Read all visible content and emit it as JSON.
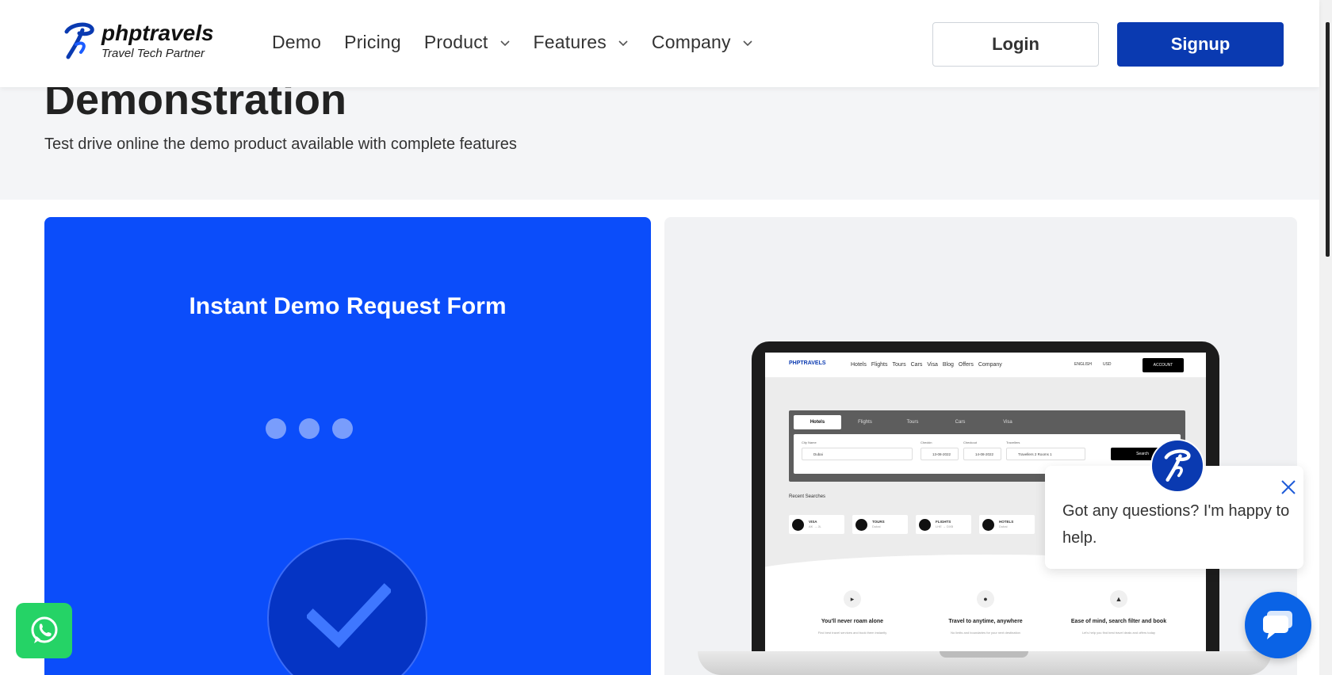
{
  "header": {
    "logo": {
      "name": "phptravels",
      "tagline": "Travel Tech Partner"
    },
    "nav": [
      {
        "label": "Demo",
        "has_dropdown": false
      },
      {
        "label": "Pricing",
        "has_dropdown": false
      },
      {
        "label": "Product",
        "has_dropdown": true
      },
      {
        "label": "Features",
        "has_dropdown": true
      },
      {
        "label": "Company",
        "has_dropdown": true
      }
    ],
    "login_label": "Login",
    "signup_label": "Signup"
  },
  "hero": {
    "title": "Demonstration",
    "subtitle": "Test drive online the demo product available with complete features"
  },
  "form_panel": {
    "title": "Instant Demo Request Form",
    "loading_dots": 3
  },
  "preview": {
    "nav_logo": "PHPTRAVELS",
    "nav_links": [
      "Hotels",
      "Flights",
      "Tours",
      "Cars",
      "Visa",
      "Blog",
      "Offers",
      "Company"
    ],
    "language": "ENGLISH",
    "currency": "USD",
    "account": "ACCOUNT",
    "tabs": [
      "Hotels",
      "Flights",
      "Tours",
      "Cars",
      "Visa"
    ],
    "labels": {
      "city": "City Name",
      "checkin": "Checkin",
      "checkout": "Checkout",
      "travellers": "Travellers"
    },
    "fields": {
      "city": "Dubai",
      "checkin": "13-08-2022",
      "checkout": "14-08-2022",
      "travellers": "Travellers 2 Rooms 1"
    },
    "search_button": "Search",
    "recent_label": "Recent Searches",
    "recent": [
      {
        "title": "VISA",
        "sub": "AK → JL"
      },
      {
        "title": "TOURS",
        "sub": "Dubai"
      },
      {
        "title": "FLIGHTS",
        "sub": "LHE → DXB"
      },
      {
        "title": "HOTELS",
        "sub": "Dubai"
      }
    ],
    "features": [
      {
        "title": "You'll never roam alone",
        "desc": "Find best travel services and book them instantly"
      },
      {
        "title": "Travel to anytime, anywhere",
        "desc": "No limits and boundaries for your next destination"
      },
      {
        "title": "Ease of mind, search filter and book",
        "desc": "Let's help you find best travel deals and offers today"
      }
    ]
  },
  "chat": {
    "message": "Got any questions? I'm happy to help."
  },
  "colors": {
    "brand_blue": "#0a3ab1",
    "form_blue": "#0b4dfa",
    "whatsapp_green": "#25d366",
    "chat_blue": "#0a63e6"
  }
}
